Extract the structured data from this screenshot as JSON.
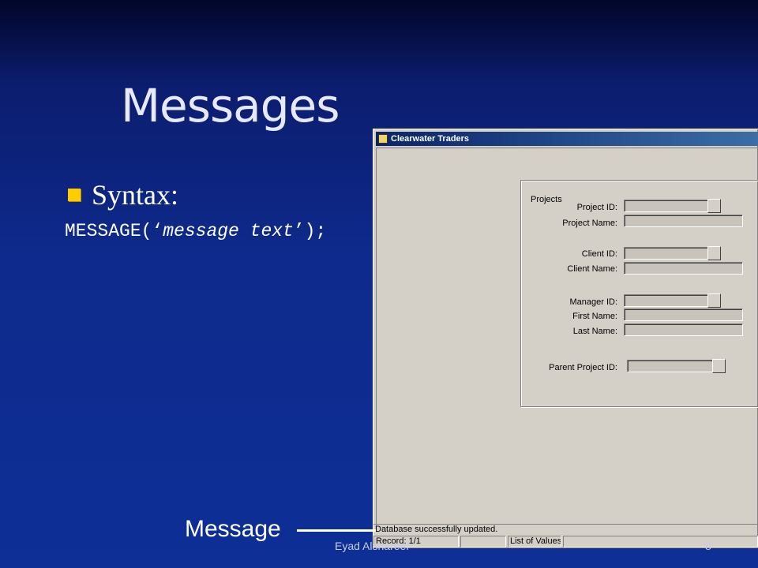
{
  "slide": {
    "title": "Messages",
    "bullet": "Syntax:",
    "code_prefix": "MESSAGE(‘",
    "code_arg": "message text",
    "code_suffix": "’);",
    "callout": "Message",
    "author": "Eyad Alshareef",
    "page": "8"
  },
  "window": {
    "title": "Clearwater Traders",
    "group_title": "Projects",
    "fields": [
      {
        "label": "Project ID:",
        "value": ""
      },
      {
        "label": "Project Name:",
        "value": ""
      },
      {
        "label": "Client ID:",
        "value": ""
      },
      {
        "label": "Client Name:",
        "value": ""
      },
      {
        "label": "Manager ID:",
        "value": ""
      },
      {
        "label": "First Name:",
        "value": ""
      },
      {
        "label": "Last Name:",
        "value": ""
      },
      {
        "label": "Parent Project ID:",
        "value": ""
      }
    ],
    "status_message": "Database successfully updated.",
    "status_record": "Record: 1/1",
    "status_lov": "List of Values"
  },
  "colors": {
    "accent_bullet": "#ffcc00",
    "titlebar": "#0a246a"
  }
}
